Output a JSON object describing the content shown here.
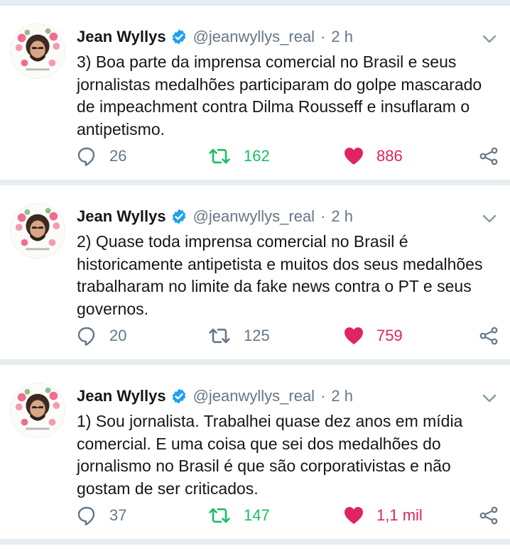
{
  "colors": {
    "retweet_active": "#17bf63",
    "like_active": "#e0245e",
    "muted": "#657786",
    "verified": "#1da1f2",
    "separator": "#e6ecf0"
  },
  "icons": {
    "reply": "reply-icon",
    "retweet": "retweet-icon",
    "like": "heart-icon",
    "share": "share-icon",
    "verified": "verified-badge-icon",
    "menu": "chevron-down-icon"
  },
  "tweets": [
    {
      "author_name": "Jean Wyllys",
      "handle": "@jeanwyllys_real",
      "separator": "·",
      "time": "2 h",
      "text": "3) Boa parte da imprensa comercial no Brasil e seus jornalistas medalhões participaram do golpe mascarado de impeachment contra Dilma Rousseff e insuflaram o antipetismo.",
      "replies": "26",
      "retweets": "162",
      "retweeted": true,
      "likes": "886",
      "liked": true
    },
    {
      "author_name": "Jean Wyllys",
      "handle": "@jeanwyllys_real",
      "separator": "·",
      "time": "2 h",
      "text": "2) Quase toda imprensa comercial no Brasil é historicamente antipetista e muitos dos seus medalhões trabalharam no limite da fake news contra o PT e seus governos.",
      "replies": "20",
      "retweets": "125",
      "retweeted": false,
      "likes": "759",
      "liked": true
    },
    {
      "author_name": "Jean Wyllys",
      "handle": "@jeanwyllys_real",
      "separator": "·",
      "time": "2 h",
      "text": "1) Sou jornalista. Trabalhei quase dez anos em mídia comercial. E uma coisa que sei dos medalhões do jornalismo no Brasil é que são corporativistas e não gostam de ser criticados.",
      "replies": "37",
      "retweets": "147",
      "retweeted": true,
      "likes": "1,1 mil",
      "liked": true
    }
  ]
}
